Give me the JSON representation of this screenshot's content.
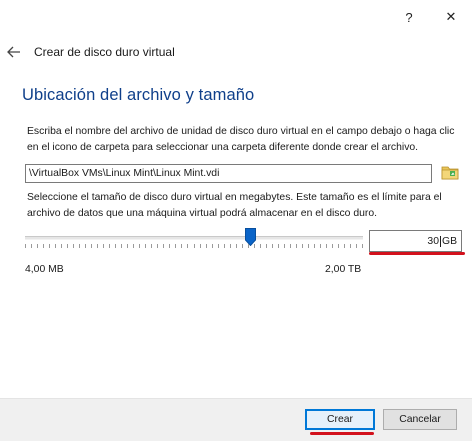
{
  "window": {
    "help_label": "?",
    "close_label": "✕"
  },
  "wizard": {
    "title": "Crear de disco duro virtual"
  },
  "section": {
    "heading": "Ubicación del archivo y tamaño",
    "location_description": "Escriba el nombre del archivo de unidad de disco duro virtual en el campo debajo o haga clic en el icono de carpeta para seleccionar una carpeta diferente donde crear el archivo.",
    "file_path": "\\VirtualBox VMs\\Linux Mint\\Linux Mint.vdi",
    "size_description": "Seleccione el tamaño de disco duro virtual en megabytes. Este tamaño es el límite para el archivo de datos que una máquina virtual podrá almacenar en el disco duro."
  },
  "size": {
    "value": "30",
    "unit": "GB",
    "slider_fraction": 0.666,
    "min_label": "4,00 MB",
    "max_label": "2,00 TB"
  },
  "buttons": {
    "create_label": "Crear",
    "cancel_label": "Cancelar"
  },
  "colors": {
    "heading": "#0f3f8a",
    "annotation_red": "#d2111c",
    "default_button_border": "#0078d7",
    "slider_thumb": "#0a64c8"
  },
  "icons": {
    "back": "back-arrow-icon",
    "folder": "folder-icon"
  }
}
